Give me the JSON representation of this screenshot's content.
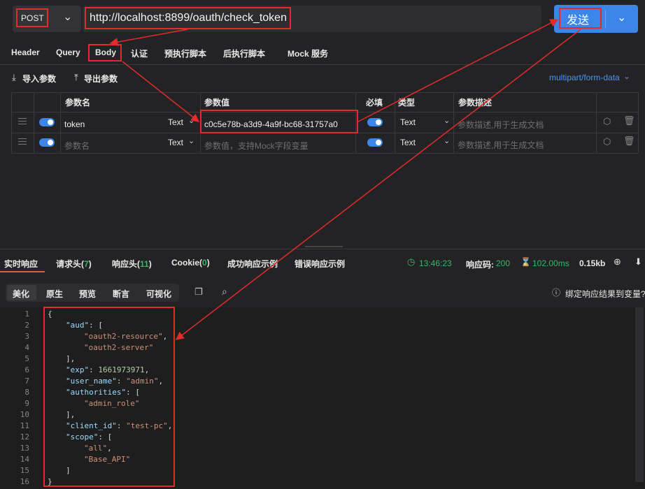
{
  "request": {
    "method": "POST",
    "url": "http://localhost:8899/oauth/check_token",
    "send_label": "发送"
  },
  "tabs": [
    "Header",
    "Query",
    "Body",
    "认证",
    "预执行脚本",
    "后执行脚本",
    "Mock 服务"
  ],
  "active_tab": "Body",
  "tools": {
    "import": "导入参数",
    "export": "导出参数",
    "encoding": "multipart/form-data"
  },
  "table": {
    "headers": {
      "name": "参数名",
      "value": "参数值",
      "required": "必填",
      "type": "类型",
      "desc": "参数描述"
    },
    "rows": [
      {
        "name": "token",
        "kind": "Text",
        "value": "c0c5e78b-a3d9-4a9f-bc68-31757a0",
        "type": "Text",
        "desc_placeholder": "参数描述,用于生成文档"
      },
      {
        "name_placeholder": "参数名",
        "kind": "Text",
        "value_placeholder": "参数值，支持Mock字段变量",
        "type": "Text",
        "desc_placeholder": "参数描述,用于生成文档"
      }
    ]
  },
  "response": {
    "tabs": {
      "realtime": "实时响应",
      "req_headers": "请求头(",
      "req_headers_count": "7",
      "resp_headers": "响应头(",
      "resp_headers_count": "11",
      "cookie": "Cookie(",
      "cookie_count": "0",
      "success_example": "成功响应示例",
      "error_example": "错误响应示例",
      "close_paren": ")"
    },
    "time": "13:46:23",
    "status_label": "响应码:",
    "status_code": "200",
    "duration": "102.00ms",
    "size": "0.15kb",
    "view_tabs": [
      "美化",
      "原生",
      "预览",
      "断言",
      "可视化"
    ],
    "bind_label": "绑定响应结果到变量?"
  },
  "code_lines": [
    {
      "n": "1",
      "t": "{"
    },
    {
      "n": "2",
      "key": "\"aud\"",
      "rest": ": ["
    },
    {
      "n": "3",
      "str": "\"oauth2-resource\"",
      "rest": ","
    },
    {
      "n": "4",
      "str": "\"oauth2-server\"",
      "rest": ""
    },
    {
      "n": "5",
      "t": "],"
    },
    {
      "n": "6",
      "key": "\"exp\"",
      "rest": ": ",
      "num": "1661973971",
      "tail": ","
    },
    {
      "n": "7",
      "key": "\"user_name\"",
      "rest": ": ",
      "str": "\"admin\"",
      "tail": ","
    },
    {
      "n": "8",
      "key": "\"authorities\"",
      "rest": ": ["
    },
    {
      "n": "9",
      "str": "\"admin_role\"",
      "rest": ""
    },
    {
      "n": "10",
      "t": "],"
    },
    {
      "n": "11",
      "key": "\"client_id\"",
      "rest": ": ",
      "str": "\"test-pc\"",
      "tail": ","
    },
    {
      "n": "12",
      "key": "\"scope\"",
      "rest": ": ["
    },
    {
      "n": "13",
      "str": "\"all\"",
      "rest": ","
    },
    {
      "n": "14",
      "str": "\"Base_API\"",
      "rest": ""
    },
    {
      "n": "15",
      "t": "]"
    },
    {
      "n": "16",
      "t": "}"
    }
  ],
  "colors": {
    "accent": "#3b86e8",
    "annotation": "#e32b2b",
    "success": "#39b56a"
  }
}
